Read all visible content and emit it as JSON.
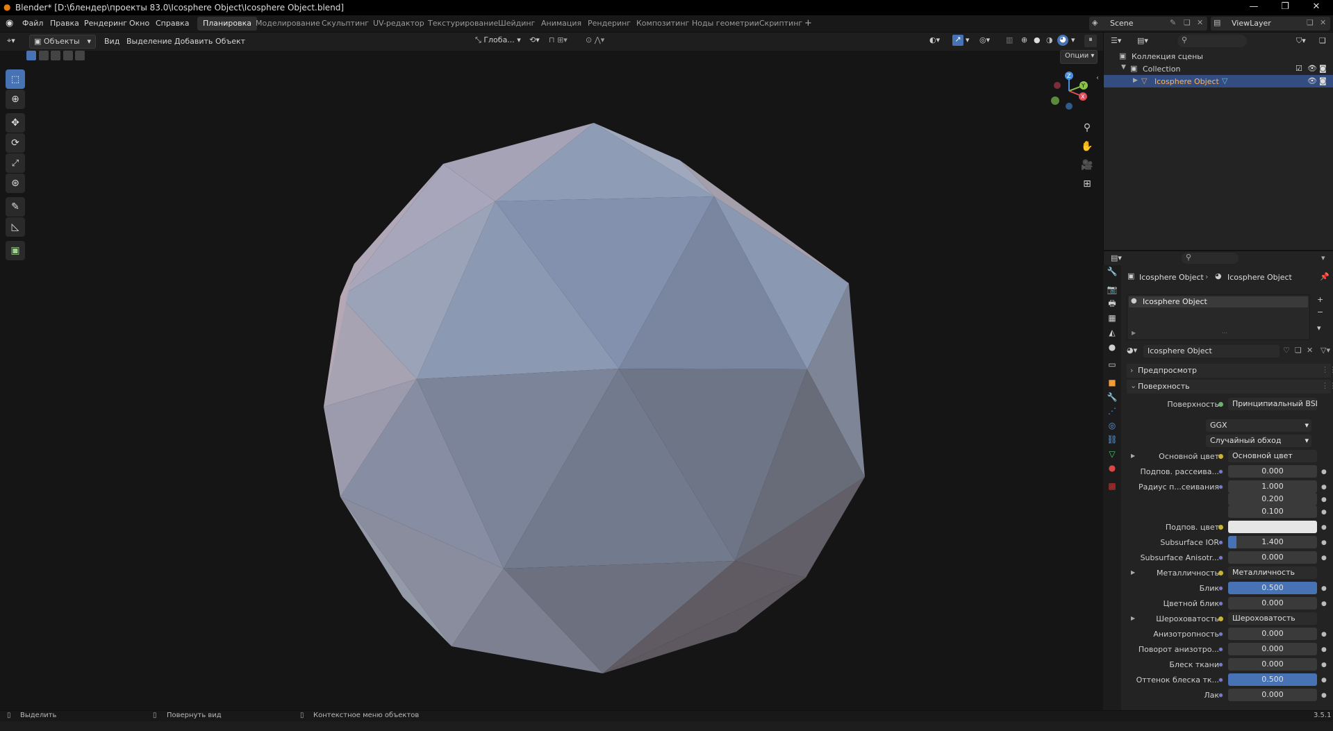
{
  "titlebar": {
    "title": "Blender* [D:\\блендер\\проекты 83.0\\Icosphere Object\\Icosphere Object.blend]"
  },
  "menubar": {
    "menus": [
      "Файл",
      "Правка",
      "Рендеринг",
      "Окно",
      "Справка"
    ],
    "workspaces": [
      "Планировка",
      "Моделирование",
      "Скульптинг",
      "UV-редактор",
      "Текстурирование",
      "Шейдинг",
      "Анимация",
      "Рендеринг",
      "Композитинг",
      "Ноды геометрии",
      "Скриптинг"
    ],
    "add_workspace": "+",
    "scene": "Scene",
    "viewlayer": "ViewLayer"
  },
  "viewport_header": {
    "mode": "Объекты",
    "menus": [
      "Вид",
      "Выделение",
      "Добавить",
      "Объект"
    ],
    "transform_orientation": "Глоба...",
    "options": "Опции"
  },
  "gizmo": {
    "x": "X",
    "y": "Y",
    "z": "Z"
  },
  "outliner": {
    "root": "Коллекция сцены",
    "collection": "Collection",
    "object": "Icosphere Object"
  },
  "properties": {
    "breadcrumb_object": "Icosphere Object",
    "breadcrumb_material": "Icosphere Object",
    "slot": "Icosphere Object",
    "material_name": "Icosphere Object",
    "panel_preview": "Предпросмотр",
    "panel_surface": "Поверхность",
    "surface_label": "Поверхность",
    "surface_value": "Принципиальный BSDF",
    "distribution": "GGX",
    "subsurface_method": "Случайный обход",
    "rows": [
      {
        "label": "Основной цвет",
        "value": "Основной цвет",
        "type": "link",
        "arrow": true
      },
      {
        "label": "Подпов. рассеива...",
        "value": "0.000",
        "type": "num"
      },
      {
        "label": "Радиус п...сеивания",
        "value": "1.000",
        "type": "num"
      },
      {
        "label": "",
        "value": "0.200",
        "type": "num"
      },
      {
        "label": "",
        "value": "0.100",
        "type": "num"
      },
      {
        "label": "Подпов. цвет",
        "value": "",
        "type": "color"
      },
      {
        "label": "Subsurface IOR",
        "value": "1.400",
        "type": "partial"
      },
      {
        "label": "Subsurface Anisotr...",
        "value": "0.000",
        "type": "num"
      },
      {
        "label": "Металличность",
        "value": "Металличность",
        "type": "link",
        "arrow": true
      },
      {
        "label": "Блик",
        "value": "0.500",
        "type": "blue"
      },
      {
        "label": "Цветной блик",
        "value": "0.000",
        "type": "num"
      },
      {
        "label": "Шероховатость",
        "value": "Шероховатость",
        "type": "link",
        "arrow": true
      },
      {
        "label": "Анизотропность",
        "value": "0.000",
        "type": "num"
      },
      {
        "label": "Поворот анизотро...",
        "value": "0.000",
        "type": "num"
      },
      {
        "label": "Блеск ткани",
        "value": "0.000",
        "type": "num"
      },
      {
        "label": "Оттенок блеска тк...",
        "value": "0.500",
        "type": "blue"
      },
      {
        "label": "Лак",
        "value": "0.000",
        "type": "num"
      }
    ]
  },
  "statusbar": {
    "select": "Выделить",
    "rotate": "Повернуть вид",
    "context": "Контекстное меню объектов",
    "version": "3.5.1"
  }
}
